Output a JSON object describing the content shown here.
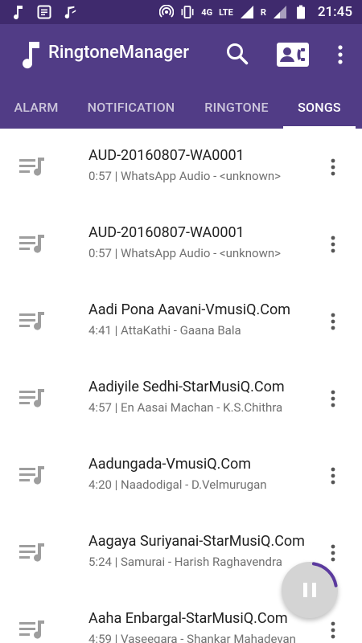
{
  "status_bar": {
    "time": "21:45",
    "network": "LTE",
    "network_small": "4G",
    "roaming": "R",
    "icons": [
      "music-note-icon",
      "message-icon",
      "music-app-icon",
      "hotspot-icon",
      "vibrate-icon",
      "signal-icon",
      "battery-icon"
    ]
  },
  "app_bar": {
    "title": "RingtoneManager",
    "icons": [
      "music-note-icon",
      "search-icon",
      "contact-icon",
      "more-vert-icon"
    ]
  },
  "tabs": [
    {
      "label": "ALARM",
      "active": false
    },
    {
      "label": "NOTIFICATION",
      "active": false
    },
    {
      "label": "RINGTONE",
      "active": false
    },
    {
      "label": "SONGS",
      "active": true
    }
  ],
  "songs": [
    {
      "title": "AUD-20160807-WA0001",
      "subtitle": "0:57 | WhatsApp Audio - <unknown>"
    },
    {
      "title": "AUD-20160807-WA0001",
      "subtitle": "0:57 | WhatsApp Audio - <unknown>"
    },
    {
      "title": "Aadi Pona Aavani-VmusiQ.Com",
      "subtitle": "4:41 | AttaKathi - Gaana Bala"
    },
    {
      "title": "Aadiyile Sedhi-StarMusiQ.Com",
      "subtitle": "4:57 | En Aasai Machan - K.S.Chithra"
    },
    {
      "title": "Aadungada-VmusiQ.Com",
      "subtitle": "4:20 | Naadodigal - D.Velmurugan"
    },
    {
      "title": "Aagaya Suriyanai-StarMusiQ.Com",
      "subtitle": "5:24 | Samurai - Harish Raghavendra"
    },
    {
      "title": "Aaha Enbargal-StarMusiQ.Com",
      "subtitle": "4:59 | Vaseegara - Shankar Mahadevan"
    }
  ],
  "player": {
    "state_icon": "pause-icon",
    "progress": 0.2
  },
  "colors": {
    "status_bar": "#3f2a6d",
    "primary": "#513c86",
    "accent_progress": "#5b3a9e",
    "list_icon": "#9e9e9e"
  }
}
